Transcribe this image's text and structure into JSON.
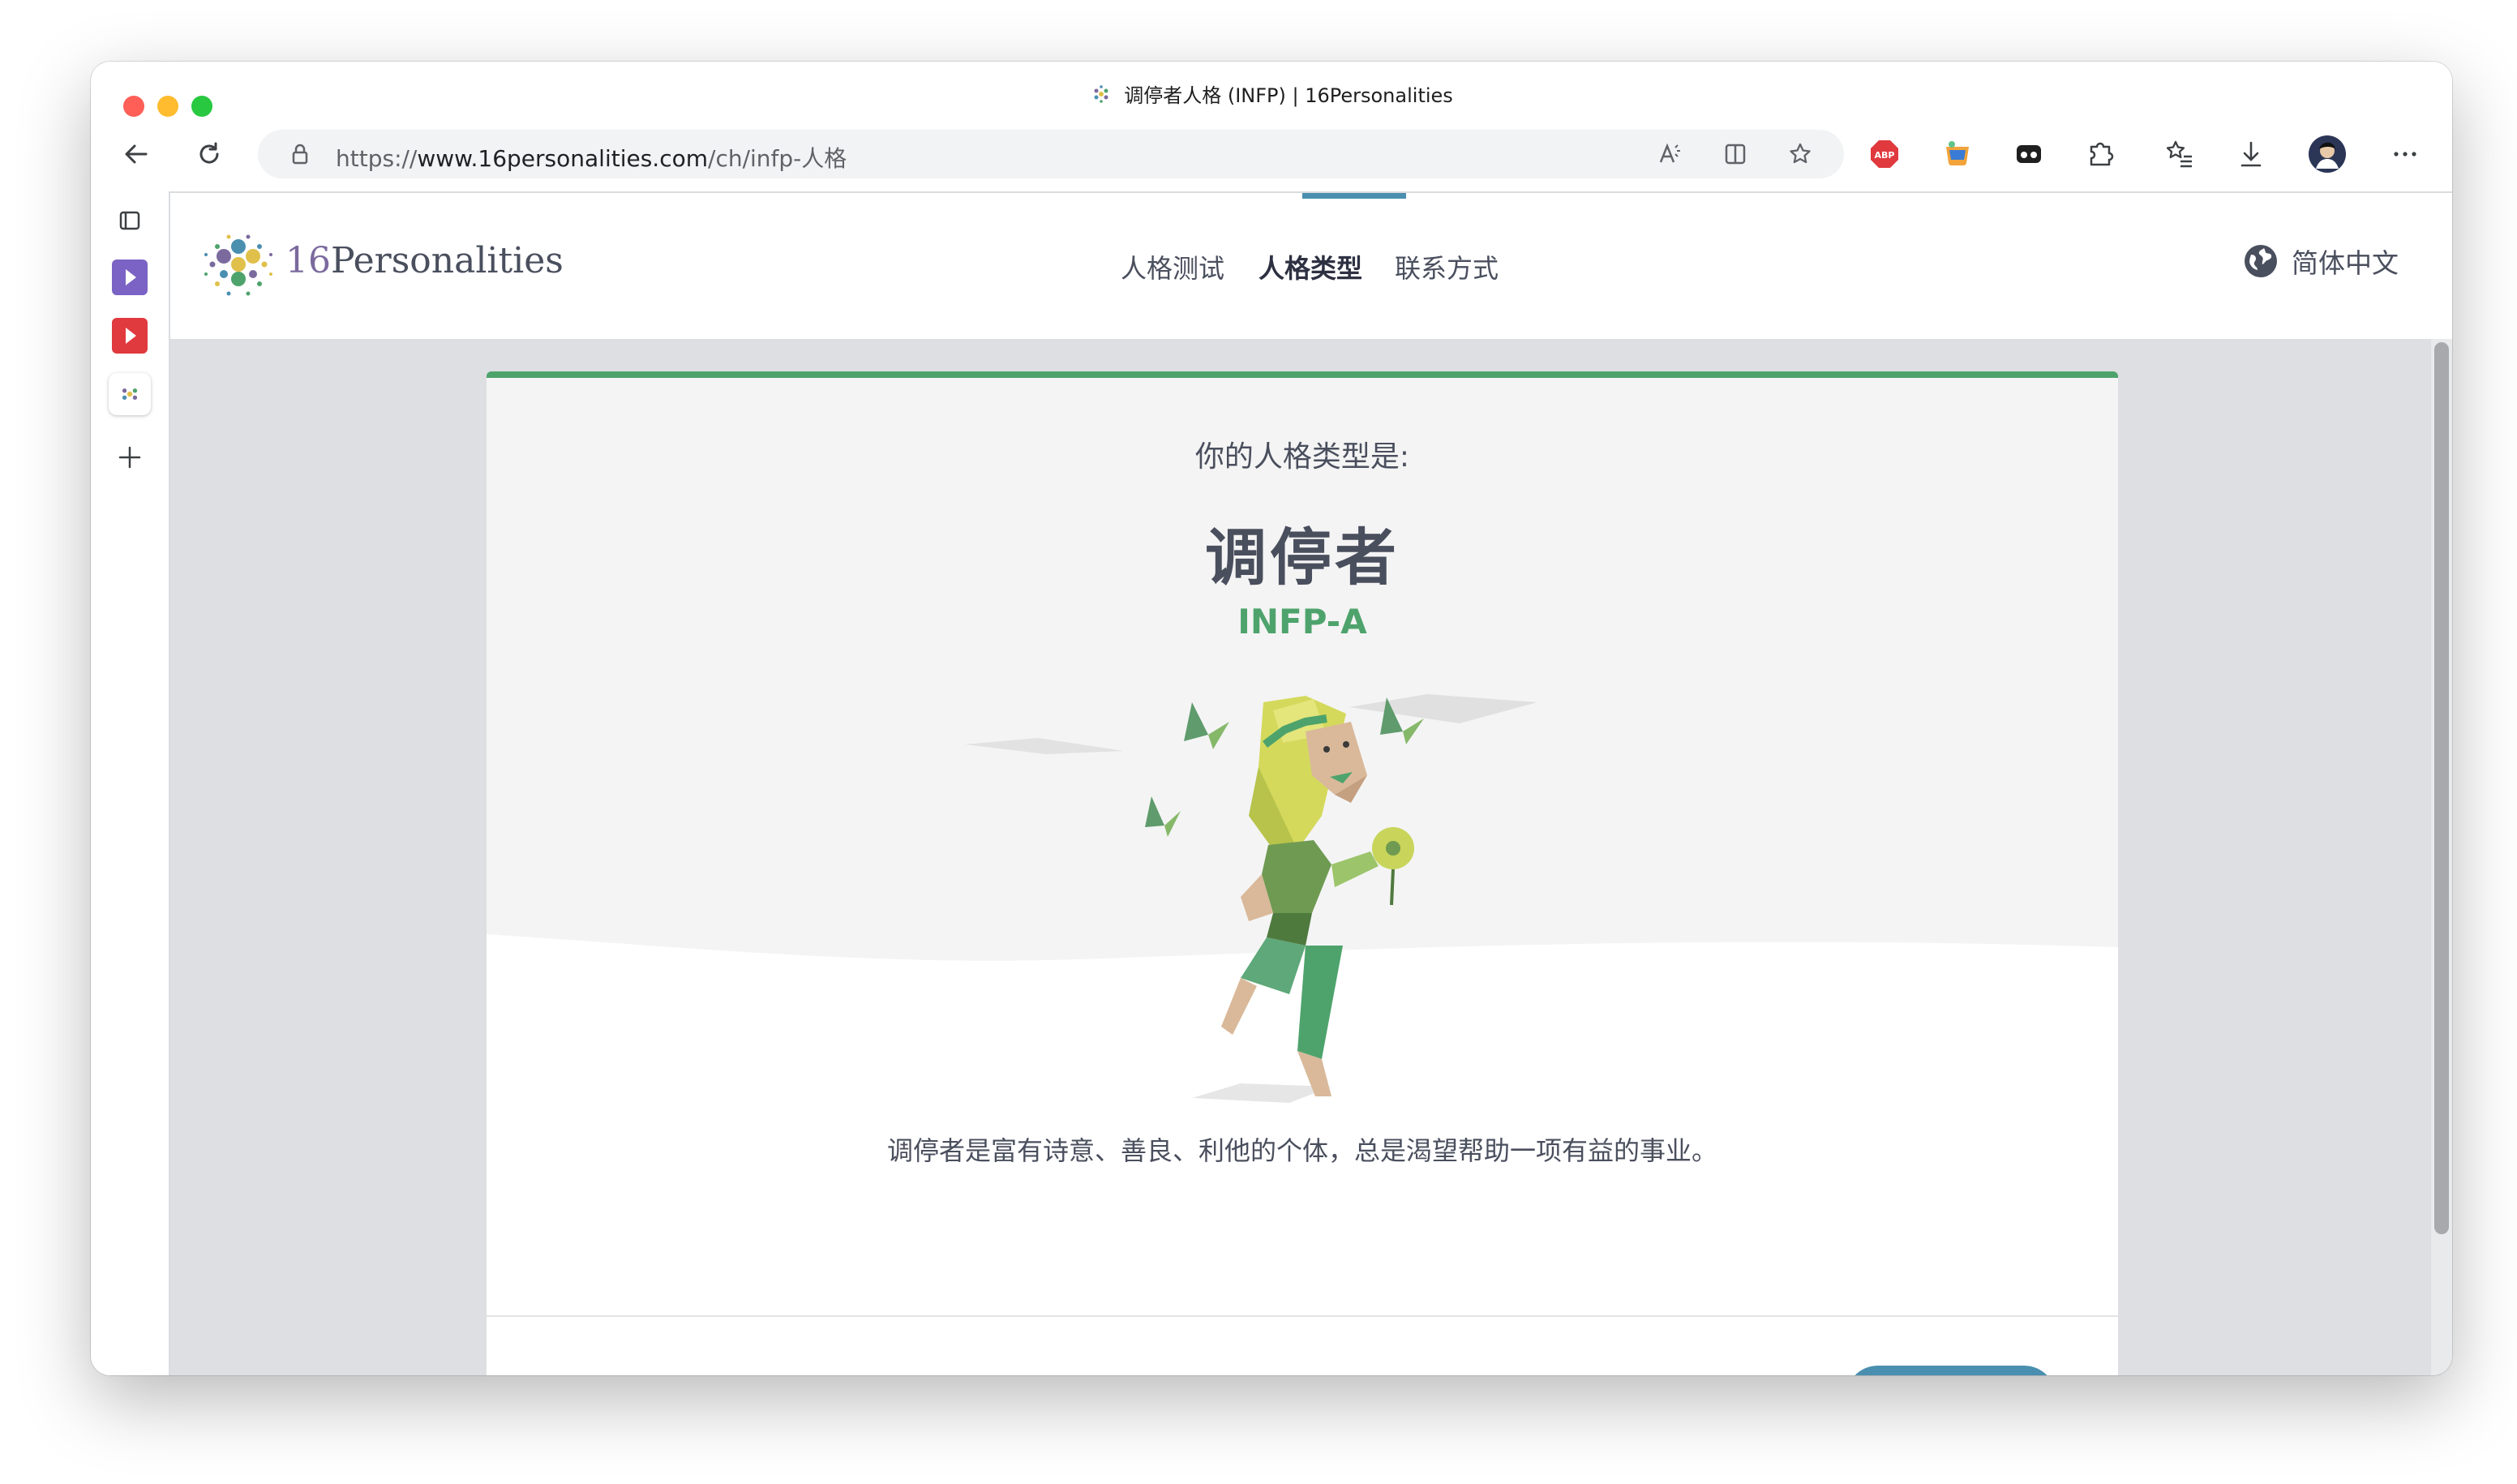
{
  "browser": {
    "tab_title": "调停者人格 (INFP) | 16Personalities",
    "url_prefix": "https://",
    "url_domain": "www.16personalities.com",
    "url_path": "/ch/infp-人格"
  },
  "site": {
    "logo_number": "16",
    "logo_word": "Personalities",
    "nav": [
      "人格测试",
      "人格类型",
      "联系方式"
    ],
    "active_nav": "人格类型",
    "language": "简体中文"
  },
  "result": {
    "prelabel": "你的人格类型是:",
    "type_name": "调停者",
    "type_code": "INFP-A",
    "description": "调停者是富有诗意、善良、利他的个体，总是渴望帮助一项有益的事业。"
  },
  "colors": {
    "accent_green": "#4ea36c",
    "accent_blue": "#4a8fb0",
    "text": "#4a4f5e"
  }
}
